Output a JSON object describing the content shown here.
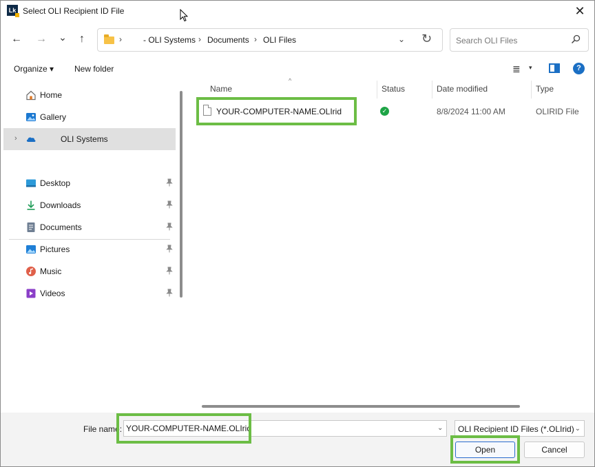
{
  "window": {
    "title": "Select OLI Recipient ID File",
    "app_icon_text": "Lk",
    "close_glyph": "✕"
  },
  "nav": {
    "back_glyph": "←",
    "forward_glyph": "→",
    "recent_glyph": "⌄",
    "up_glyph": "↑"
  },
  "address": {
    "crumbs": [
      "- OLI Systems",
      "Documents",
      "OLI Files"
    ],
    "separator": "›",
    "dropdown_glyph": "⌄",
    "refresh_glyph": "↻"
  },
  "search": {
    "placeholder": "Search OLI Files"
  },
  "commands": {
    "organize": "Organize ▾",
    "new_folder": "New folder",
    "view_glyph": "≣",
    "view_dropdown": "▾",
    "help": "?"
  },
  "sidebar": {
    "items": [
      {
        "label": "Home",
        "icon": "home-icon"
      },
      {
        "label": "Gallery",
        "icon": "gallery-icon"
      },
      {
        "label": "OLI Systems",
        "icon": "onedrive-cloud-icon",
        "selected": true,
        "expand": "›"
      },
      {
        "label": "Desktop",
        "icon": "desktop-icon",
        "pinned": true
      },
      {
        "label": "Downloads",
        "icon": "downloads-icon",
        "pinned": true
      },
      {
        "label": "Documents",
        "icon": "documents-icon",
        "pinned": true
      },
      {
        "label": "Pictures",
        "icon": "pictures-icon",
        "pinned": true
      },
      {
        "label": "Music",
        "icon": "music-icon",
        "pinned": true
      },
      {
        "label": "Videos",
        "icon": "videos-icon",
        "pinned": true
      }
    ]
  },
  "file_list": {
    "sort_glyph": "^",
    "columns": [
      "Name",
      "Status",
      "Date modified",
      "Type"
    ],
    "rows": [
      {
        "name": "YOUR-COMPUTER-NAME.OLIrid",
        "status": "synced",
        "status_glyph": "✓",
        "date_modified": "8/8/2024 11:00 AM",
        "type": "OLIRID File"
      }
    ]
  },
  "footer": {
    "file_name_label": "File name:",
    "file_name_value": "YOUR-COMPUTER-NAME.OLIrid",
    "file_name_dropdown": "⌄",
    "file_type": "OLI Recipient ID Files (*.OLIrid)",
    "file_type_chevron": "⌄",
    "open_label": "Open",
    "cancel_label": "Cancel"
  },
  "colors": {
    "highlight": "#6cbd45",
    "accent": "#1b6fc4",
    "status_ok": "#1ea446"
  }
}
